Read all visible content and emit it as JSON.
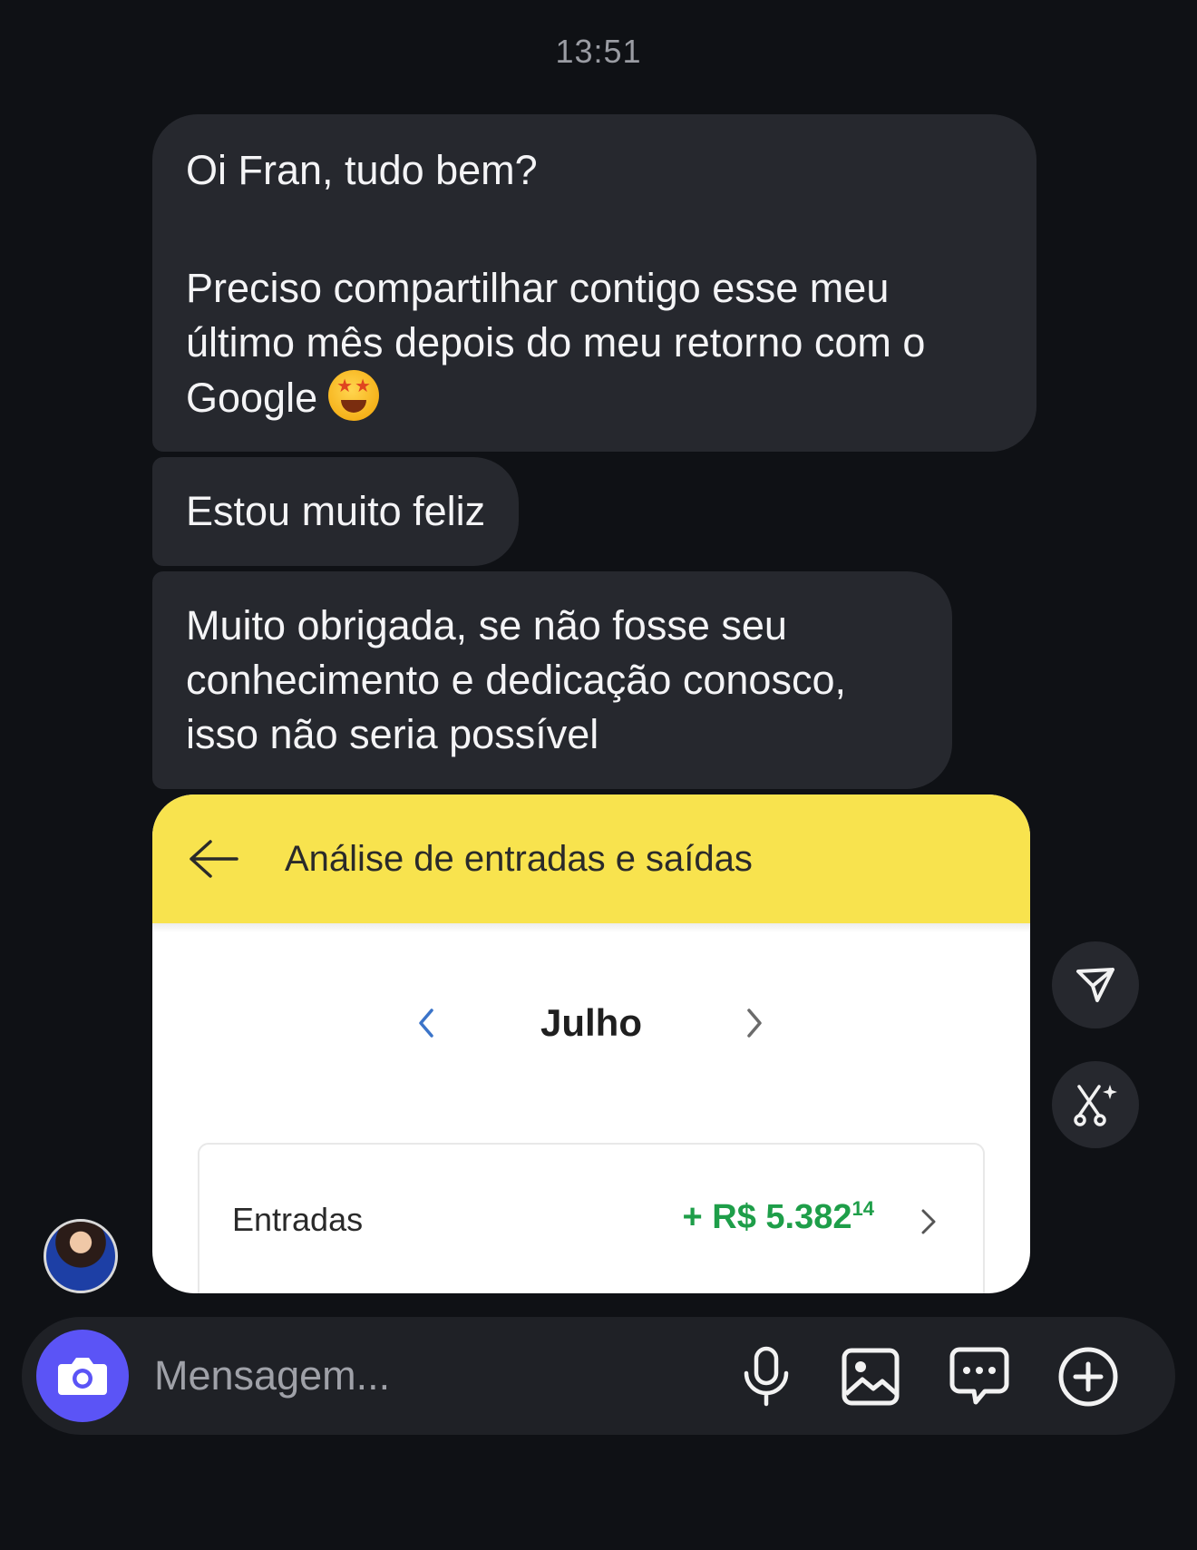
{
  "chat": {
    "timestamp": "13:51",
    "messages": [
      {
        "line1": "Oi Fran, tudo bem?",
        "line2": "Preciso compartilhar contigo esse meu último mês depois do meu retorno com o Google",
        "emoji": "star-struck-emoji"
      },
      {
        "text": "Estou muito feliz"
      },
      {
        "text": "Muito obrigada, se não fosse seu conhecimento e dedicação conosco, isso não seria possível"
      }
    ]
  },
  "shared_card": {
    "header_title": "Análise de entradas e saídas",
    "month": "Julho",
    "income_label": "Entradas",
    "income_prefix": "+ R$ 5.382",
    "income_cents": "14",
    "header_color": "#f8e34e",
    "income_color": "#1e9e49"
  },
  "composer": {
    "placeholder": "Mensagem...",
    "accent_color": "#5b54f6",
    "icons": [
      "camera-icon",
      "microphone-icon",
      "gallery-icon",
      "sticker-icon",
      "plus-icon"
    ]
  },
  "side_actions": [
    "share-icon",
    "ai-sparkle-icon"
  ]
}
